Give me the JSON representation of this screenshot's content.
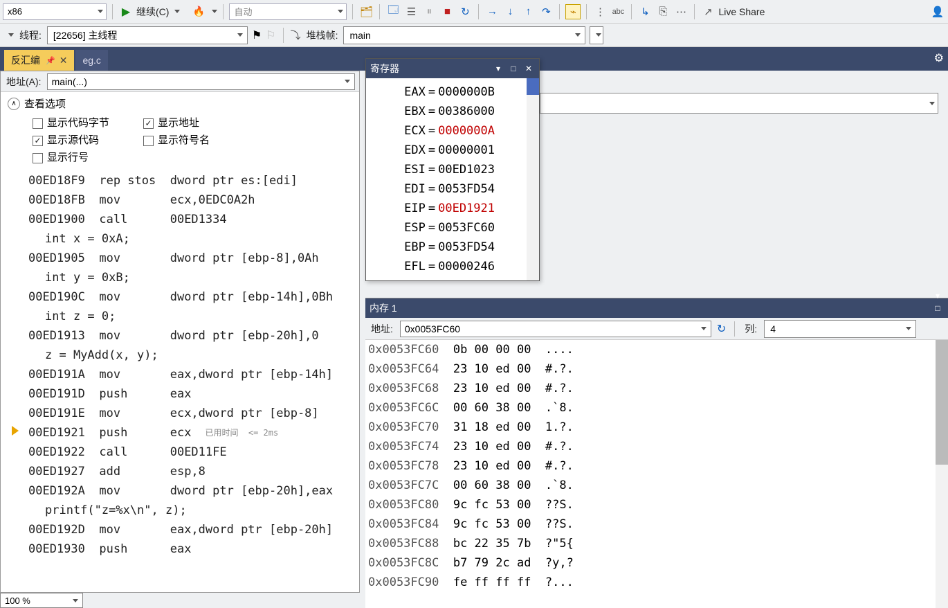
{
  "toolbar": {
    "arch": "x86",
    "continue_label": "继续(C)",
    "flame_dropdown": "",
    "mode": "自动",
    "live_share": "Live Share"
  },
  "toolbar2": {
    "thread_label": "线程:",
    "thread_value": "[22656] 主线程",
    "stack_label": "堆栈帧:",
    "stack_value": "main"
  },
  "tabs": {
    "active": "反汇编",
    "other": "eg.c"
  },
  "disasm": {
    "addr_label": "地址(A):",
    "addr_value": "main(...)",
    "opts_title": "查看选项",
    "opt_code_bytes": "显示代码字节",
    "opt_address": "显示地址",
    "opt_source": "显示源代码",
    "opt_symbol": "显示符号名",
    "opt_lineno": "显示行号",
    "elapsed": "已用时间  <= 2ms",
    "lines": [
      {
        "addr": "00ED18F9",
        "op": "rep stos",
        "args": "dword ptr es:[edi]"
      },
      {
        "addr": "00ED18FB",
        "op": "mov",
        "args": "ecx,0EDC0A2h"
      },
      {
        "addr": "00ED1900",
        "op": "call",
        "args": "00ED1334"
      },
      {
        "src": "int x = 0xA;"
      },
      {
        "addr": "00ED1905",
        "op": "mov",
        "args": "dword ptr [ebp-8],0Ah"
      },
      {
        "src": "int y = 0xB;"
      },
      {
        "addr": "00ED190C",
        "op": "mov",
        "args": "dword ptr [ebp-14h],0Bh"
      },
      {
        "src": "int z = 0;"
      },
      {
        "addr": "00ED1913",
        "op": "mov",
        "args": "dword ptr [ebp-20h],0"
      },
      {
        "src": "z = MyAdd(x, y);"
      },
      {
        "addr": "00ED191A",
        "op": "mov",
        "args": "eax,dword ptr [ebp-14h]"
      },
      {
        "addr": "00ED191D",
        "op": "push",
        "args": "eax"
      },
      {
        "addr": "00ED191E",
        "op": "mov",
        "args": "ecx,dword ptr [ebp-8]"
      },
      {
        "addr": "00ED1921",
        "op": "push",
        "args": "ecx",
        "current": true,
        "elapsed": true
      },
      {
        "addr": "00ED1922",
        "op": "call",
        "args": "00ED11FE"
      },
      {
        "addr": "00ED1927",
        "op": "add",
        "args": "esp,8"
      },
      {
        "addr": "00ED192A",
        "op": "mov",
        "args": "dword ptr [ebp-20h],eax"
      },
      {
        "src": "printf(\"z=%x\\n\", z);"
      },
      {
        "addr": "00ED192D",
        "op": "mov",
        "args": "eax,dword ptr [ebp-20h]"
      },
      {
        "addr": "00ED1930",
        "op": "push",
        "args": "eax"
      }
    ]
  },
  "registers": {
    "title": "寄存器",
    "rows": [
      {
        "name": "EAX",
        "val": "0000000B"
      },
      {
        "name": "EBX",
        "val": "00386000"
      },
      {
        "name": "ECX",
        "val": "0000000A",
        "red": true
      },
      {
        "name": "EDX",
        "val": "00000001"
      },
      {
        "name": "ESI",
        "val": "00ED1023"
      },
      {
        "name": "EDI",
        "val": "0053FD54"
      },
      {
        "name": "EIP",
        "val": "00ED1921",
        "red": true
      },
      {
        "name": "ESP",
        "val": "0053FC60"
      },
      {
        "name": "EBP",
        "val": "0053FD54"
      },
      {
        "name": "EFL",
        "val": "00000246"
      }
    ]
  },
  "memory": {
    "title": "内存 1",
    "addr_label": "地址:",
    "addr_value": "0x0053FC60",
    "cols_label": "列:",
    "cols_value": "4",
    "rows": [
      {
        "addr": "0x0053FC60",
        "hex": "0b 00 00 00",
        "txt": "...."
      },
      {
        "addr": "0x0053FC64",
        "hex": "23 10 ed 00",
        "txt": "#.?."
      },
      {
        "addr": "0x0053FC68",
        "hex": "23 10 ed 00",
        "txt": "#.?."
      },
      {
        "addr": "0x0053FC6C",
        "hex": "00 60 38 00",
        "txt": ".`8."
      },
      {
        "addr": "0x0053FC70",
        "hex": "31 18 ed 00",
        "txt": "1.?."
      },
      {
        "addr": "0x0053FC74",
        "hex": "23 10 ed 00",
        "txt": "#.?."
      },
      {
        "addr": "0x0053FC78",
        "hex": "23 10 ed 00",
        "txt": "#.?."
      },
      {
        "addr": "0x0053FC7C",
        "hex": "00 60 38 00",
        "txt": ".`8."
      },
      {
        "addr": "0x0053FC80",
        "hex": "9c fc 53 00",
        "txt": "??S."
      },
      {
        "addr": "0x0053FC84",
        "hex": "9c fc 53 00",
        "txt": "??S."
      },
      {
        "addr": "0x0053FC88",
        "hex": "bc 22 35 7b",
        "txt": "?\"5{"
      },
      {
        "addr": "0x0053FC8C",
        "hex": "b7 79 2c ad",
        "txt": "?y,?"
      },
      {
        "addr": "0x0053FC90",
        "hex": "fe ff ff ff",
        "txt": "?..."
      }
    ]
  },
  "zoom": "100 %"
}
